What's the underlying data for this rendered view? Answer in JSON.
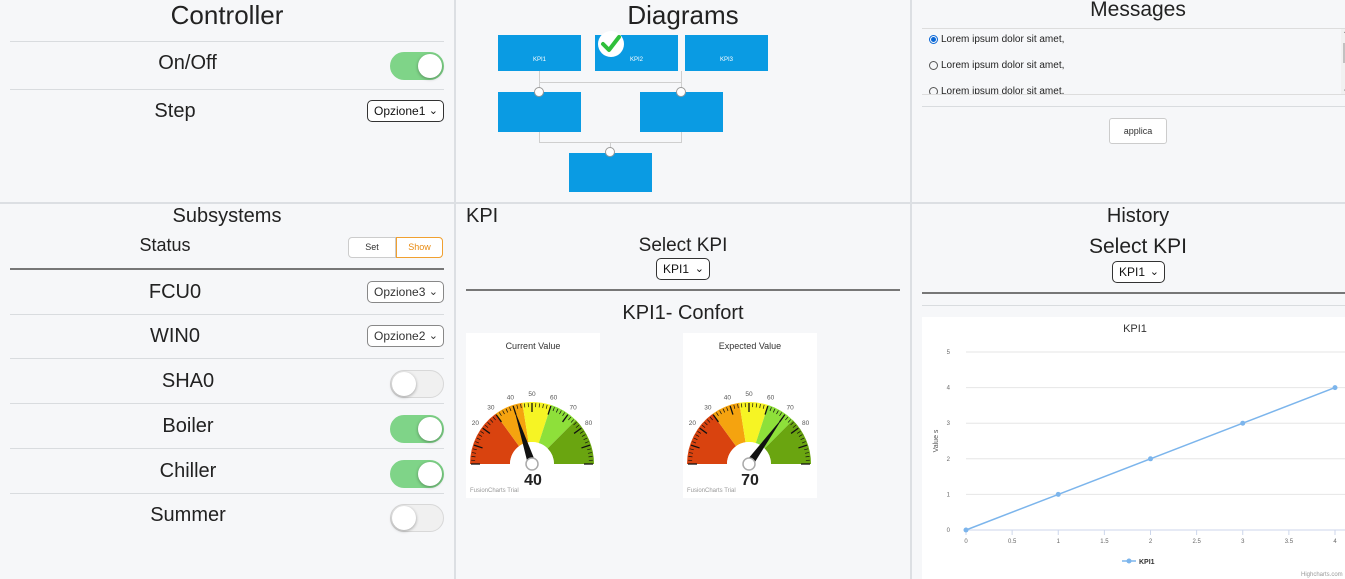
{
  "controller": {
    "title": "Controller",
    "onoff_label": "On/Off",
    "onoff_state": true,
    "step_label": "Step",
    "step_value": "Opzione1"
  },
  "diagrams": {
    "title": "Diagrams",
    "top_boxes": [
      "KPI1",
      "KPI2",
      "KPI3"
    ]
  },
  "messages": {
    "title": "Messages",
    "items": [
      {
        "text": "Lorem ipsum dolor sit amet,",
        "selected": true
      },
      {
        "text": "Lorem ipsum dolor sit amet,",
        "selected": false
      },
      {
        "text": "Lorem ipsum dolor sit amet.",
        "selected": false
      }
    ],
    "apply_label": "applica"
  },
  "subsystems": {
    "title": "Subsystems",
    "status_label": "Status",
    "set_label": "Set",
    "show_label": "Show",
    "rows": [
      {
        "name": "FCU0",
        "type": "select",
        "value": "Opzione3"
      },
      {
        "name": "WIN0",
        "type": "select",
        "value": "Opzione2"
      },
      {
        "name": "SHA0",
        "type": "toggle",
        "on": false
      },
      {
        "name": "Boiler",
        "type": "toggle",
        "on": true
      },
      {
        "name": "Chiller",
        "type": "toggle",
        "on": true
      },
      {
        "name": "Summer",
        "type": "toggle",
        "on": false
      }
    ]
  },
  "kpi": {
    "title": "KPI",
    "select_label": "Select KPI",
    "select_value": "KPI1",
    "subtitle": "KPI1- Confort",
    "gauges": [
      {
        "title": "Current Value",
        "value": 40,
        "trial": "FusionCharts Trial"
      },
      {
        "title": "Expected Value",
        "value": 70,
        "trial": "FusionCharts Trial"
      }
    ],
    "gauge_ticks": [
      "20",
      "30",
      "40",
      "50",
      "60",
      "70",
      "80"
    ]
  },
  "history": {
    "title": "History",
    "select_label": "Select KPI",
    "select_value": "KPI1",
    "credit": "Highcharts.com"
  },
  "chart_data": {
    "type": "line",
    "title": "KPI1",
    "ylabel": "Value s",
    "xlabel": "",
    "x": [
      0,
      1,
      2,
      3,
      4
    ],
    "series": [
      {
        "name": "KPI1",
        "values": [
          0,
          1,
          2,
          3,
          4
        ]
      }
    ],
    "xlim": [
      0,
      4
    ],
    "ylim": [
      0,
      5
    ],
    "x_ticks": [
      "0",
      "0.5",
      "1",
      "1.5",
      "2",
      "2.5",
      "3",
      "3.5",
      "4"
    ],
    "y_ticks": [
      "0",
      "1",
      "2",
      "3",
      "4",
      "5"
    ],
    "grid": true,
    "legend": "bottom-center",
    "color": "#7cb5ec"
  }
}
